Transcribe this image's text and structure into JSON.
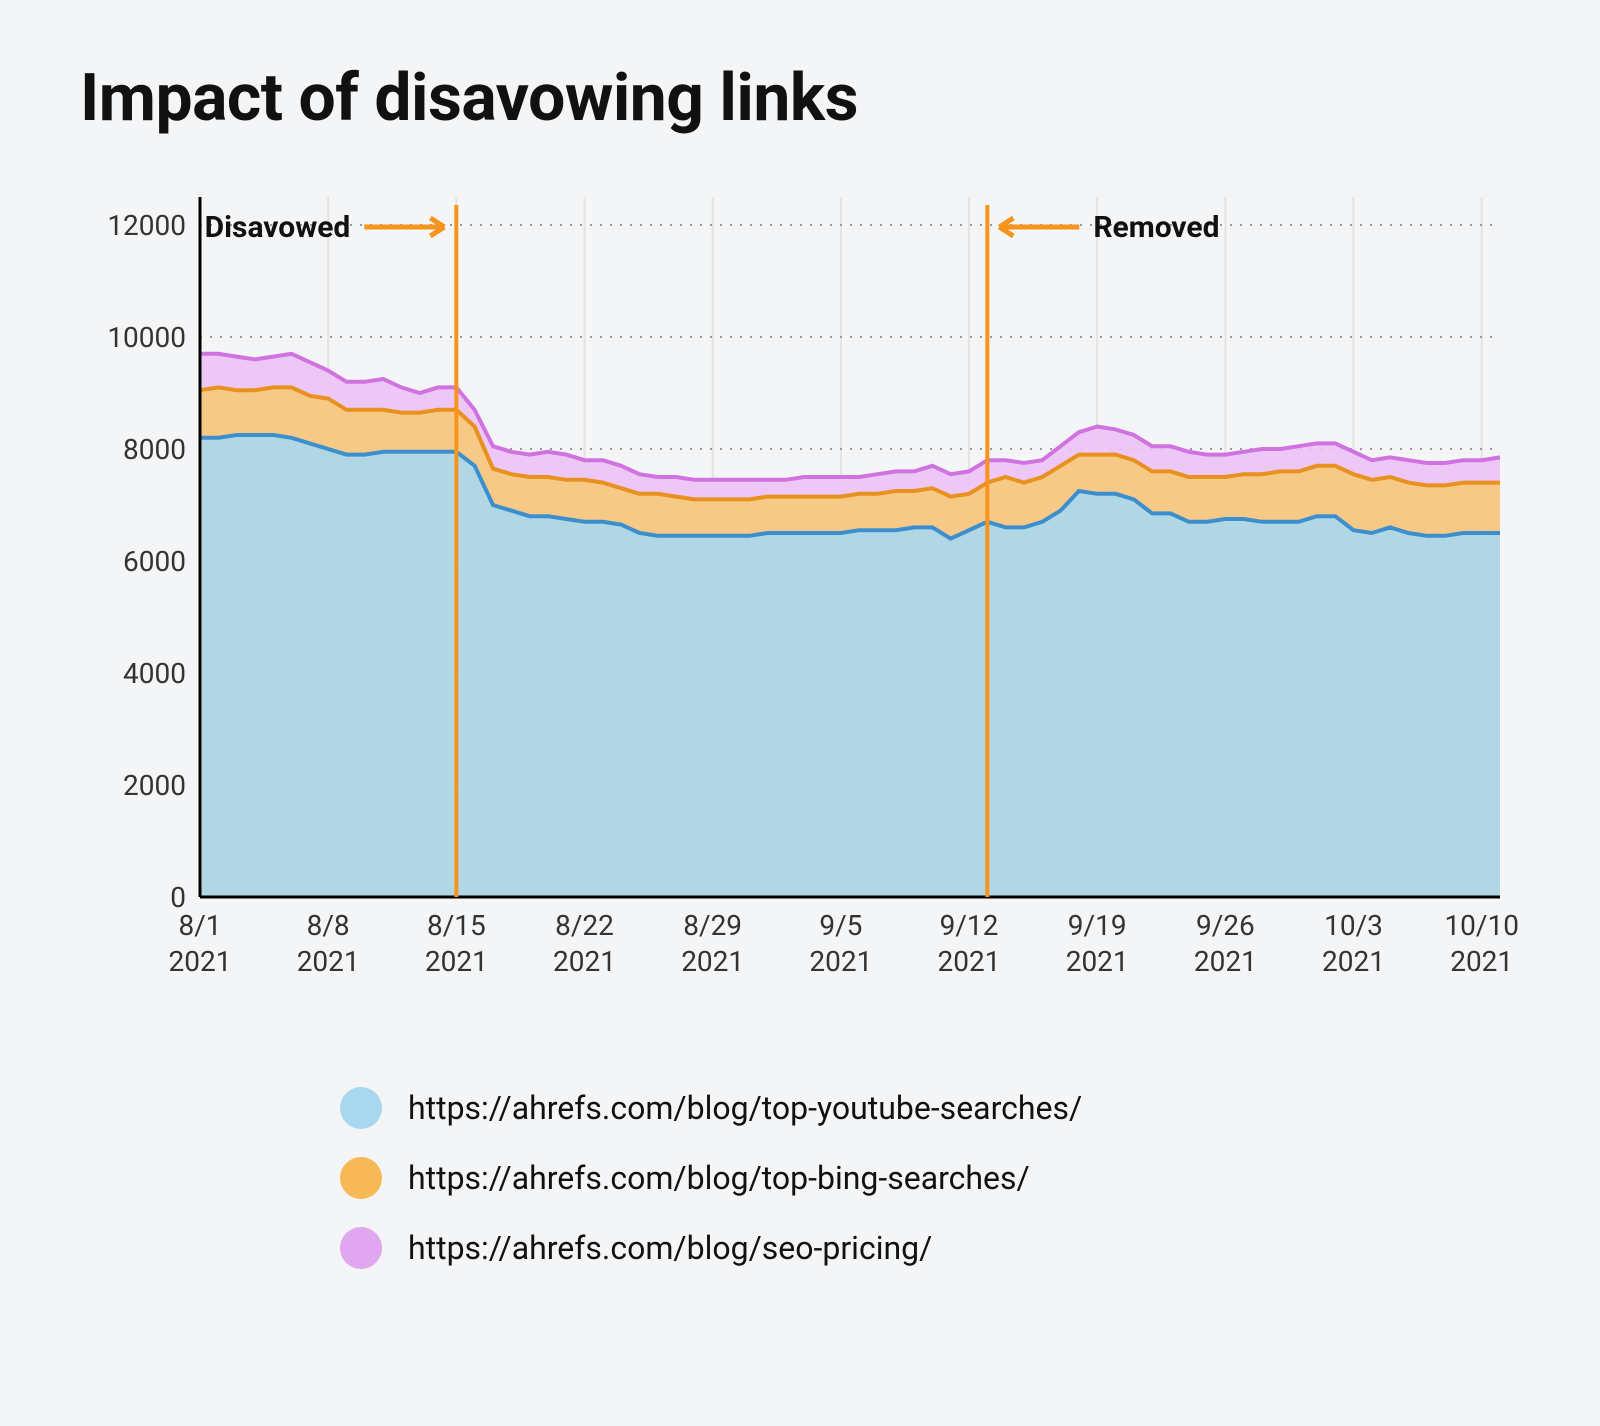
{
  "title": "Impact of disavowing links",
  "annotations": {
    "left": "Disavowed",
    "right": "Removed"
  },
  "legend": [
    {
      "color": "#a8d8f0",
      "label": "https://ahrefs.com/blog/top-youtube-searches/"
    },
    {
      "color": "#f7b955",
      "label": "https://ahrefs.com/blog/top-bing-searches/"
    },
    {
      "color": "#e0a7f0",
      "label": "https://ahrefs.com/blog/seo-pricing/"
    }
  ],
  "chart_data": {
    "type": "area",
    "title": "Impact of disavowing links",
    "xlabel": "",
    "ylabel": "",
    "ylim": [
      0,
      12500
    ],
    "y_ticks": [
      0,
      2000,
      4000,
      6000,
      8000,
      10000,
      12000
    ],
    "categories": [
      "8/1 2021",
      "8/8 2021",
      "8/15 2021",
      "8/22 2021",
      "8/29 2021",
      "9/5 2021",
      "9/12 2021",
      "9/19 2021",
      "9/26 2021",
      "10/3 2021",
      "10/10 2021"
    ],
    "x": [
      0,
      1,
      2,
      3,
      4,
      5,
      6,
      7,
      8,
      9,
      10,
      11,
      12,
      13,
      14,
      15,
      16,
      17,
      18,
      19,
      20,
      21,
      22,
      23,
      24,
      25,
      26,
      27,
      28,
      29,
      30,
      31,
      32,
      33,
      34,
      35,
      36,
      37,
      38,
      39,
      40,
      41,
      42,
      43,
      44,
      45,
      46,
      47,
      48,
      49,
      50,
      51,
      52,
      53,
      54,
      55,
      56,
      57,
      58,
      59,
      60,
      61,
      62,
      63,
      64,
      65,
      66,
      67,
      68,
      69,
      70,
      71
    ],
    "series": [
      {
        "name": "https://ahrefs.com/blog/top-youtube-searches/",
        "color_fill": "#a8d8f0",
        "color_stroke": "#3c8fcf",
        "values": [
          8200,
          8200,
          8250,
          8250,
          8250,
          8200,
          8100,
          8000,
          7900,
          7900,
          7950,
          7950,
          7950,
          7950,
          7950,
          7700,
          7000,
          6900,
          6800,
          6800,
          6750,
          6700,
          6700,
          6650,
          6500,
          6450,
          6450,
          6450,
          6450,
          6450,
          6450,
          6500,
          6500,
          6500,
          6500,
          6500,
          6550,
          6550,
          6550,
          6600,
          6600,
          6400,
          6550,
          6700,
          6600,
          6600,
          6700,
          6900,
          7250,
          7200,
          7200,
          7100,
          6850,
          6850,
          6700,
          6700,
          6750,
          6750,
          6700,
          6700,
          6700,
          6800,
          6800,
          6550,
          6500,
          6600,
          6500,
          6450,
          6450,
          6500,
          6500,
          6500
        ]
      },
      {
        "name": "https://ahrefs.com/blog/top-bing-searches/",
        "color_fill": "#f7c97a",
        "color_stroke": "#e8911f",
        "values": [
          9050,
          9100,
          9050,
          9050,
          9100,
          9100,
          8950,
          8900,
          8700,
          8700,
          8700,
          8650,
          8650,
          8700,
          8700,
          8400,
          7650,
          7550,
          7500,
          7500,
          7450,
          7450,
          7400,
          7300,
          7200,
          7200,
          7150,
          7100,
          7100,
          7100,
          7100,
          7150,
          7150,
          7150,
          7150,
          7150,
          7200,
          7200,
          7250,
          7250,
          7300,
          7150,
          7200,
          7400,
          7500,
          7400,
          7500,
          7700,
          7900,
          7900,
          7900,
          7800,
          7600,
          7600,
          7500,
          7500,
          7500,
          7550,
          7550,
          7600,
          7600,
          7700,
          7700,
          7550,
          7450,
          7500,
          7400,
          7350,
          7350,
          7400,
          7400,
          7400
        ]
      },
      {
        "name": "https://ahrefs.com/blog/seo-pricing/",
        "color_fill": "#ecc3f5",
        "color_stroke": "#d073e0",
        "values": [
          9700,
          9700,
          9650,
          9600,
          9650,
          9700,
          9550,
          9400,
          9200,
          9200,
          9250,
          9100,
          9000,
          9100,
          9100,
          8700,
          8050,
          7950,
          7900,
          7950,
          7900,
          7800,
          7800,
          7700,
          7550,
          7500,
          7500,
          7450,
          7450,
          7450,
          7450,
          7450,
          7450,
          7500,
          7500,
          7500,
          7500,
          7550,
          7600,
          7600,
          7700,
          7550,
          7600,
          7800,
          7800,
          7750,
          7800,
          8050,
          8300,
          8400,
          8350,
          8250,
          8050,
          8050,
          7950,
          7900,
          7900,
          7950,
          8000,
          8000,
          8050,
          8100,
          8100,
          7950,
          7800,
          7850,
          7800,
          7750,
          7750,
          7800,
          7800,
          7850
        ]
      }
    ],
    "markers": [
      {
        "label": "Disavowed",
        "x_index": 14,
        "side": "left"
      },
      {
        "label": "Removed",
        "x_index": 43,
        "side": "right"
      }
    ]
  }
}
